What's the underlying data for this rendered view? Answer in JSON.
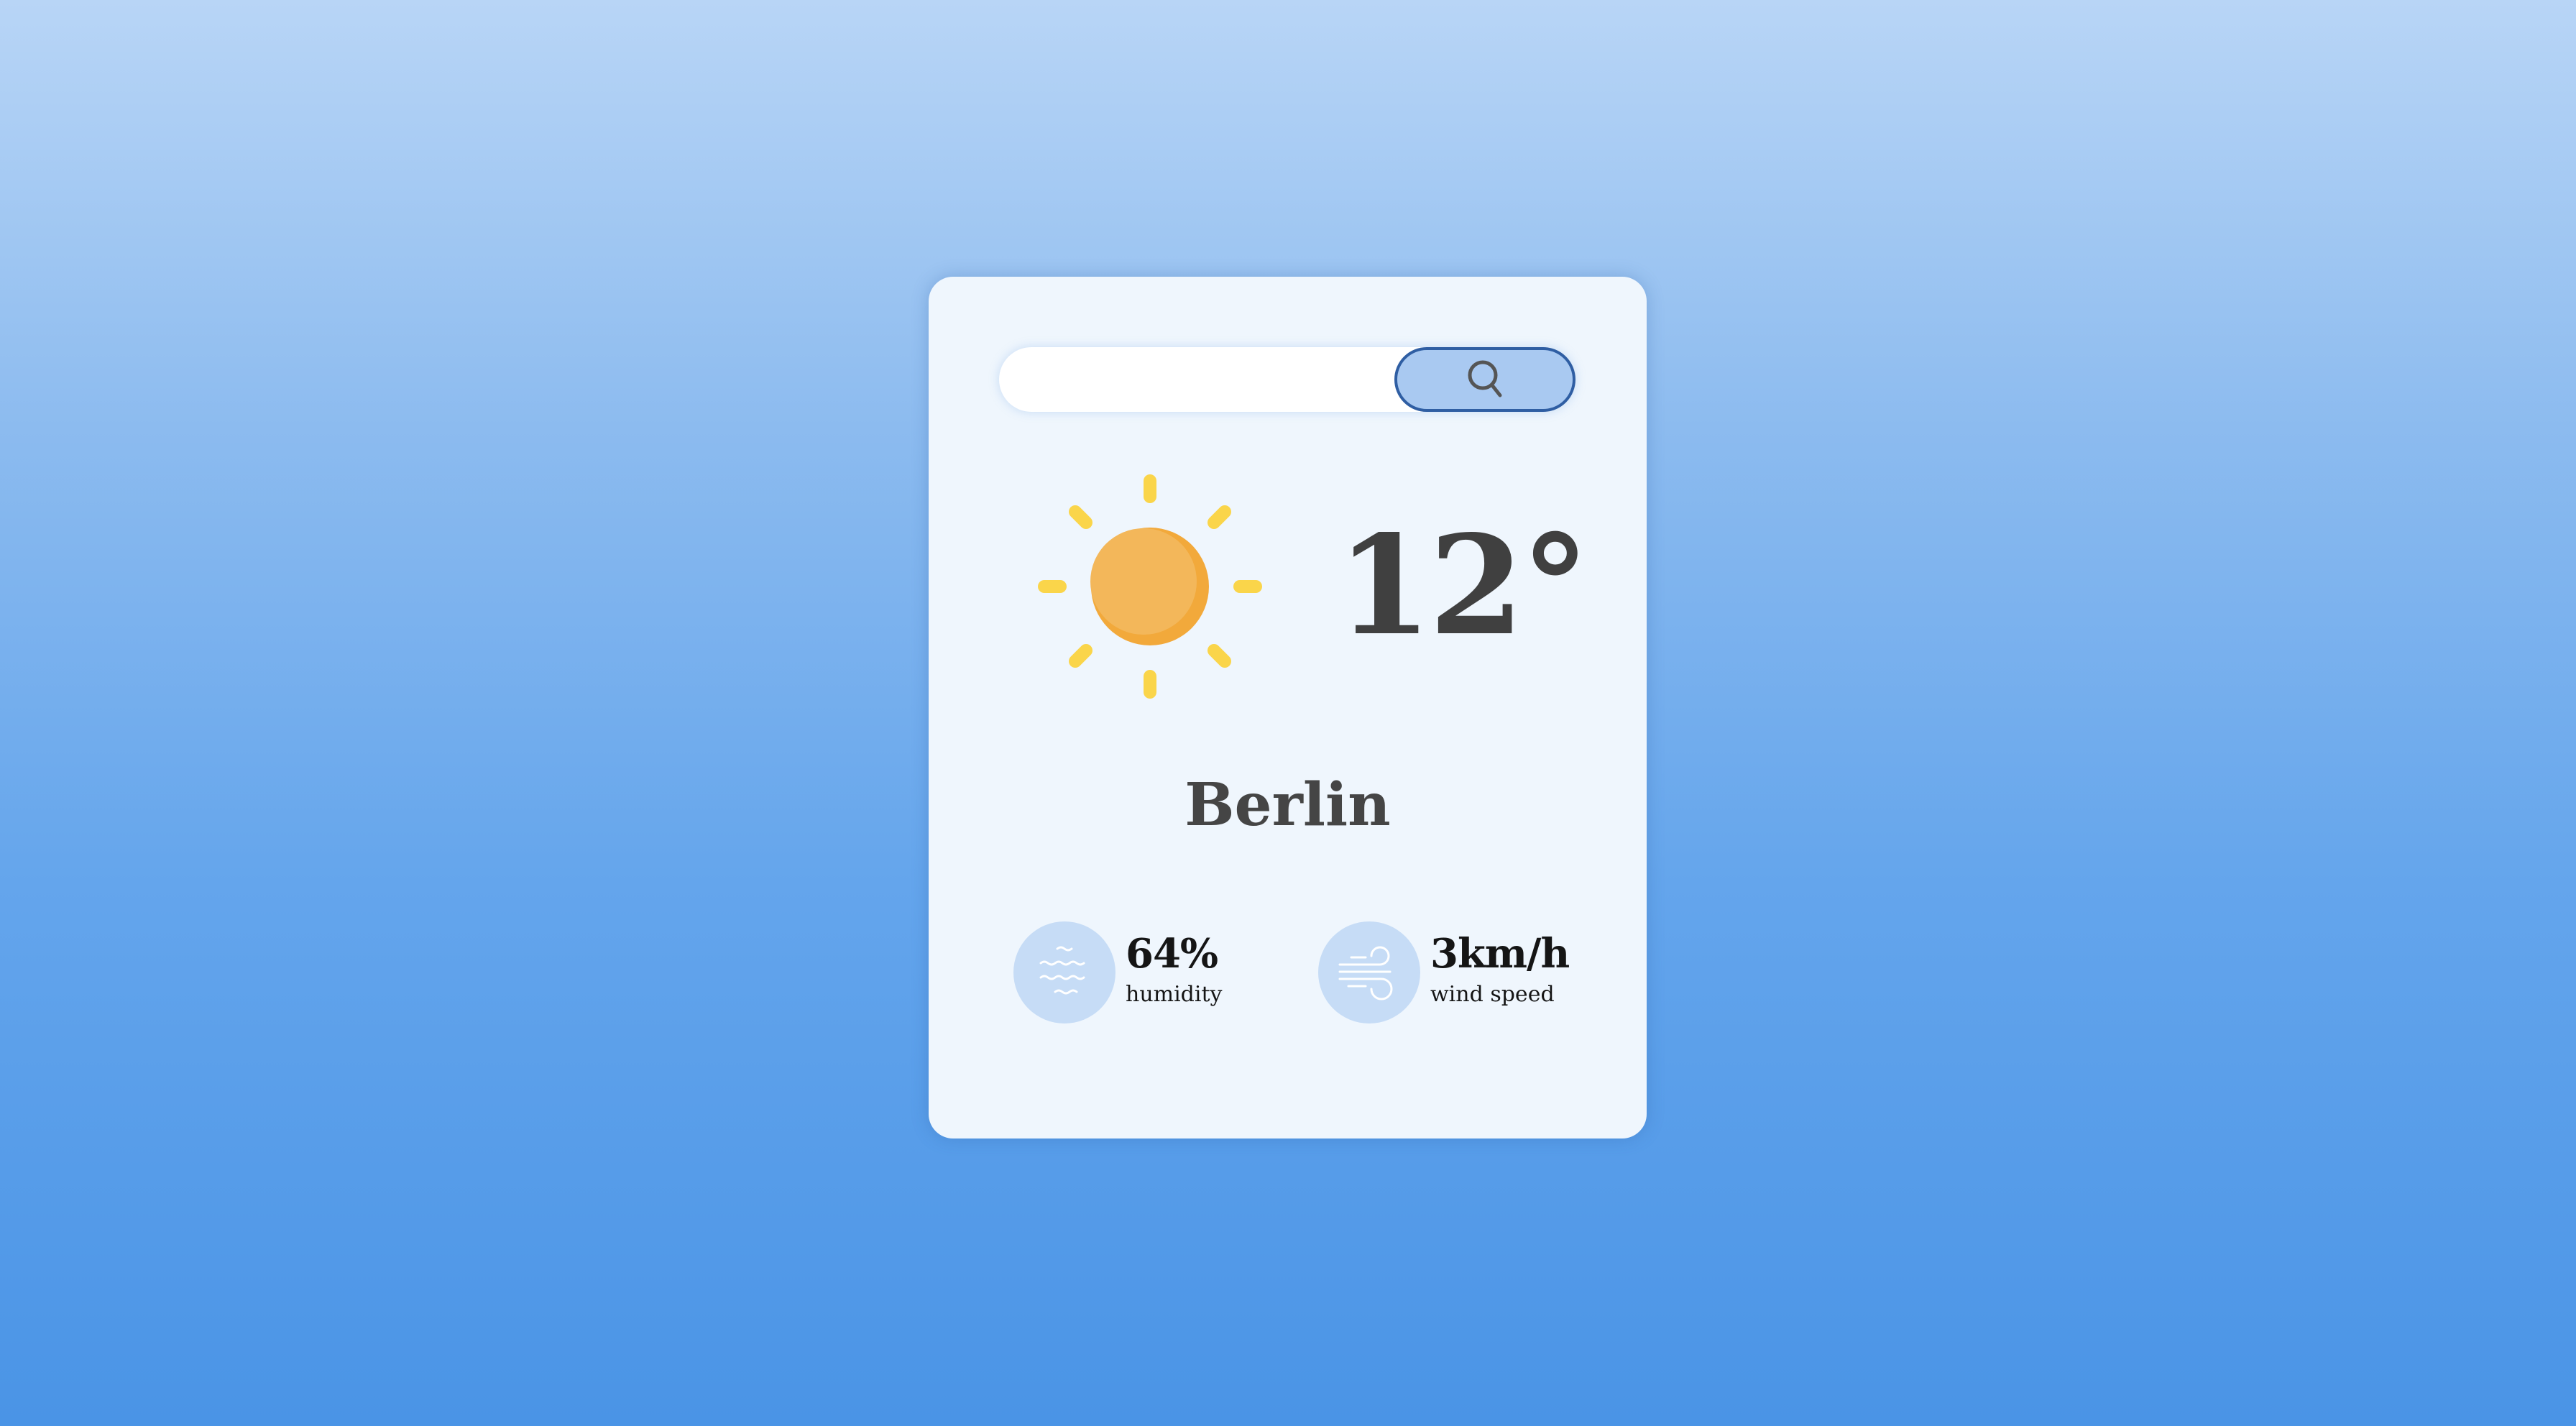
{
  "search": {
    "value": "",
    "placeholder": "",
    "button_icon": "search-icon"
  },
  "weather": {
    "icon": "sun-icon",
    "temperature": "12°",
    "city": "Berlin"
  },
  "details": {
    "humidity": {
      "icon": "humidity-waves-icon",
      "value": "64%",
      "label": "humidity"
    },
    "wind": {
      "icon": "wind-icon",
      "value": "3km/h",
      "label": "wind speed"
    }
  },
  "colors": {
    "background_top": "#b8d5f6",
    "background_bottom": "#4a94e6",
    "card": "#eff6fd",
    "search_button": "#a9c9f1",
    "search_button_border": "#2f5ea3",
    "sun_core": "#f3b75a",
    "sun_rays": "#fad54a",
    "detail_icon_bg": "#c6dcf6",
    "temperature_text": "#404040"
  }
}
